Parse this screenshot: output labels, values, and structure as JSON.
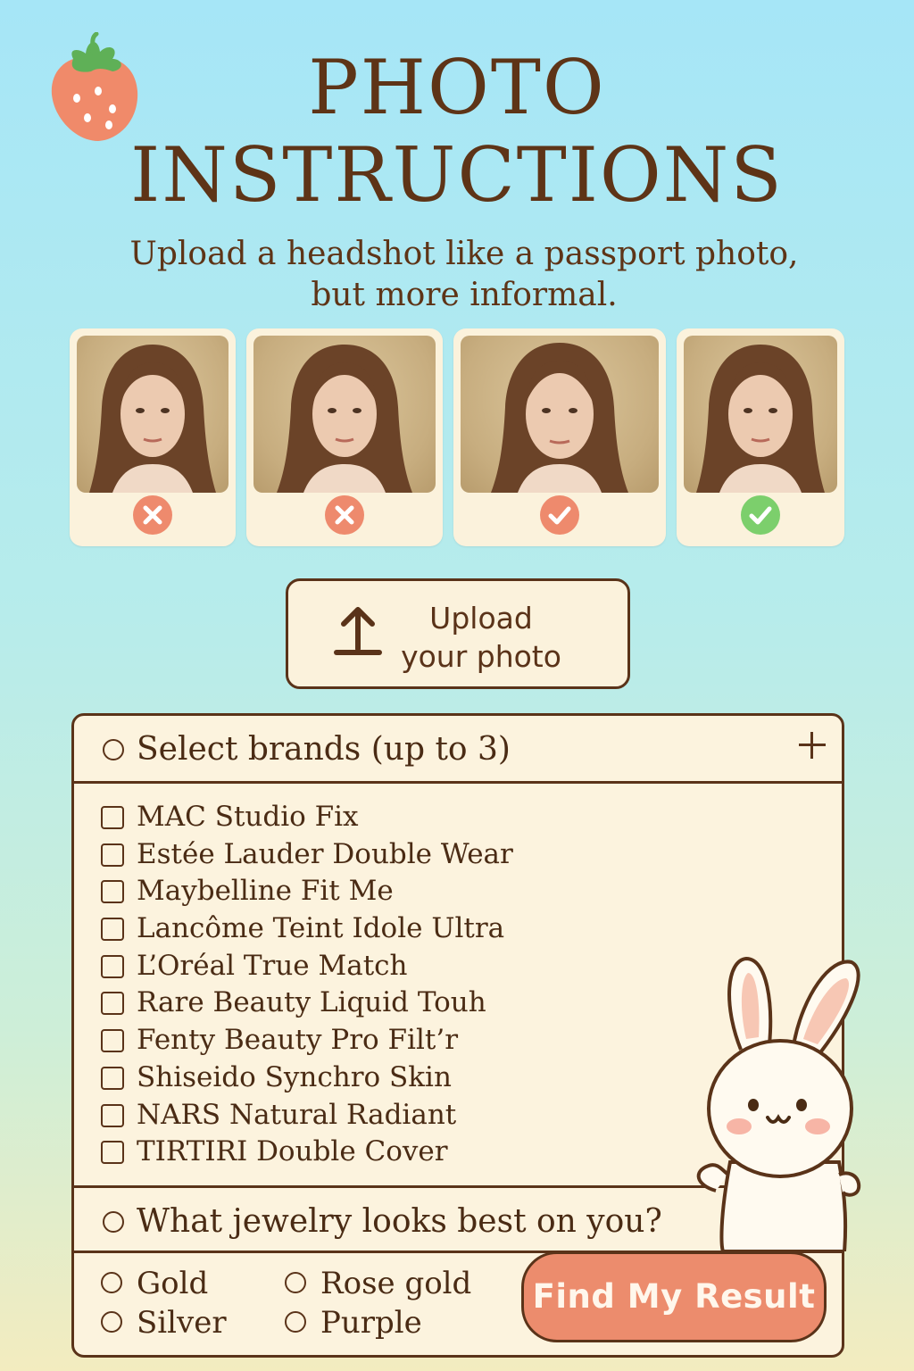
{
  "header": {
    "title_line1": "PHOTO",
    "title_line2": "INSTRUCTIONS",
    "subtitle": "Upload a headshot like a passport photo, but more informal."
  },
  "examples": [
    {
      "status": "rejected",
      "icon": "x-circle-icon",
      "color": "#ee8a6d"
    },
    {
      "status": "rejected",
      "icon": "x-circle-icon",
      "color": "#ee8a6d"
    },
    {
      "status": "accepted",
      "icon": "check-circle-icon",
      "color": "#ee8a6d"
    },
    {
      "status": "accepted",
      "icon": "check-circle-icon",
      "color": "#7ccf6c"
    }
  ],
  "upload": {
    "label": "Upload your photo",
    "icon": "upload-icon"
  },
  "brands": {
    "heading": "Select brands (up to 3)",
    "expand_icon": "plus-icon",
    "items": [
      "MAC Studio Fix",
      "Estée Lauder Double Wear",
      "Maybelline Fit Me",
      "Lancôme Teint Idole Ultra",
      "L’Oréal True Match",
      "Rare Beauty Liquid Touh",
      "Fenty Beauty Pro Filt’r",
      "Shiseido Synchro Skin",
      "NARS Natural Radiant",
      "TIRTIRI Double Cover"
    ]
  },
  "jewelry": {
    "heading": "What jewelry looks best on you?",
    "options": [
      "Gold",
      "Silver",
      "Rose gold",
      "Purple"
    ]
  },
  "submit": {
    "label": "Find My Result"
  },
  "colors": {
    "accent": "#ec8c6d",
    "text": "#5a3319",
    "card": "#fcf3de"
  }
}
